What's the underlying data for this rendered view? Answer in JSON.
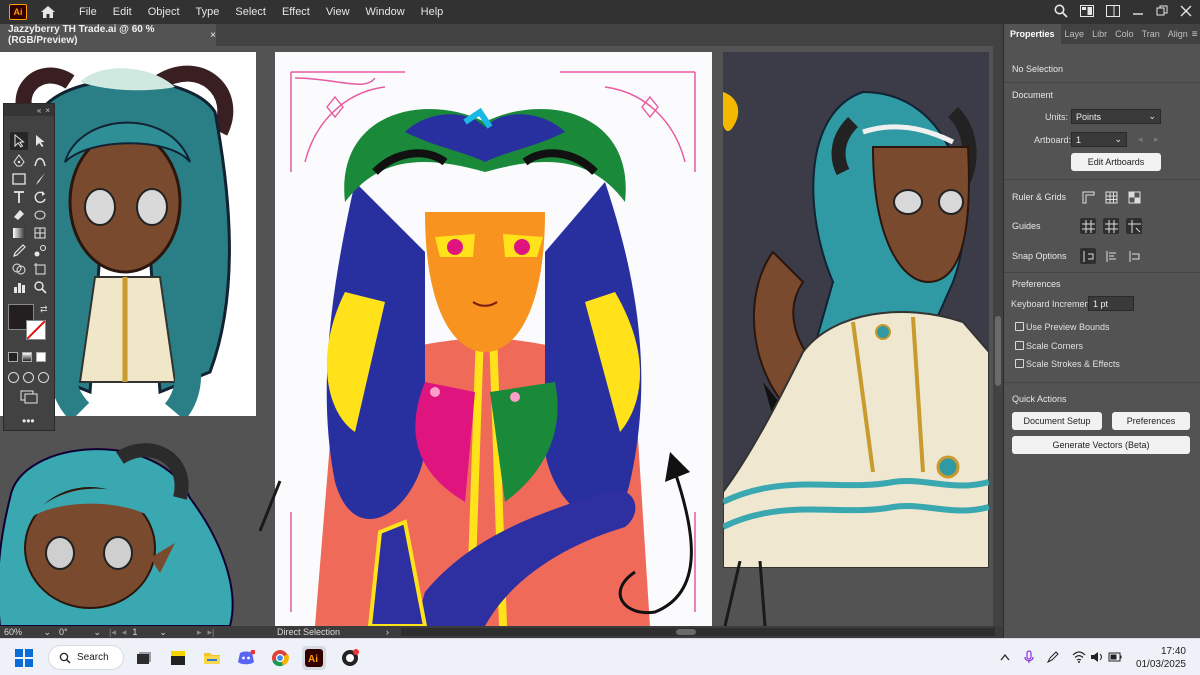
{
  "app": {
    "logo_text": "Ai",
    "menus": [
      "File",
      "Edit",
      "Object",
      "Type",
      "Select",
      "Effect",
      "View",
      "Window",
      "Help"
    ]
  },
  "document": {
    "tab_title": "Jazzyberry TH Trade.ai @ 60 % (RGB/Preview)",
    "close_glyph": "×"
  },
  "status": {
    "zoom": "60%",
    "rotation": "0°",
    "artboard": "1",
    "tool_name": "Direct Selection"
  },
  "properties": {
    "tabs": [
      "Properties",
      "Laye",
      "Libr",
      "Colo",
      "Tran",
      "Align"
    ],
    "no_selection": "No Selection",
    "document_heading": "Document",
    "units_label": "Units:",
    "units_value": "Points",
    "artboard_label": "Artboard:",
    "artboard_value": "1",
    "edit_artboards": "Edit Artboards",
    "ruler_grids": "Ruler & Grids",
    "guides": "Guides",
    "snap_options": "Snap Options",
    "preferences_heading": "Preferences",
    "keyboard_increment_label": "Keyboard Increment:",
    "keyboard_increment_value": "1 pt",
    "use_preview_bounds": "Use Preview Bounds",
    "scale_corners": "Scale Corners",
    "scale_strokes": "Scale Strokes & Effects",
    "quick_actions_heading": "Quick Actions",
    "document_setup_btn": "Document Setup",
    "preferences_btn": "Preferences",
    "generate_vectors_btn": "Generate Vectors (Beta)"
  },
  "taskbar": {
    "search_label": "Search",
    "time": "17:40",
    "date": "01/03/2025"
  },
  "colors": {
    "accent_ai": "#ff9a00",
    "ui_dark": "#323232",
    "ui_panel": "#535353"
  }
}
